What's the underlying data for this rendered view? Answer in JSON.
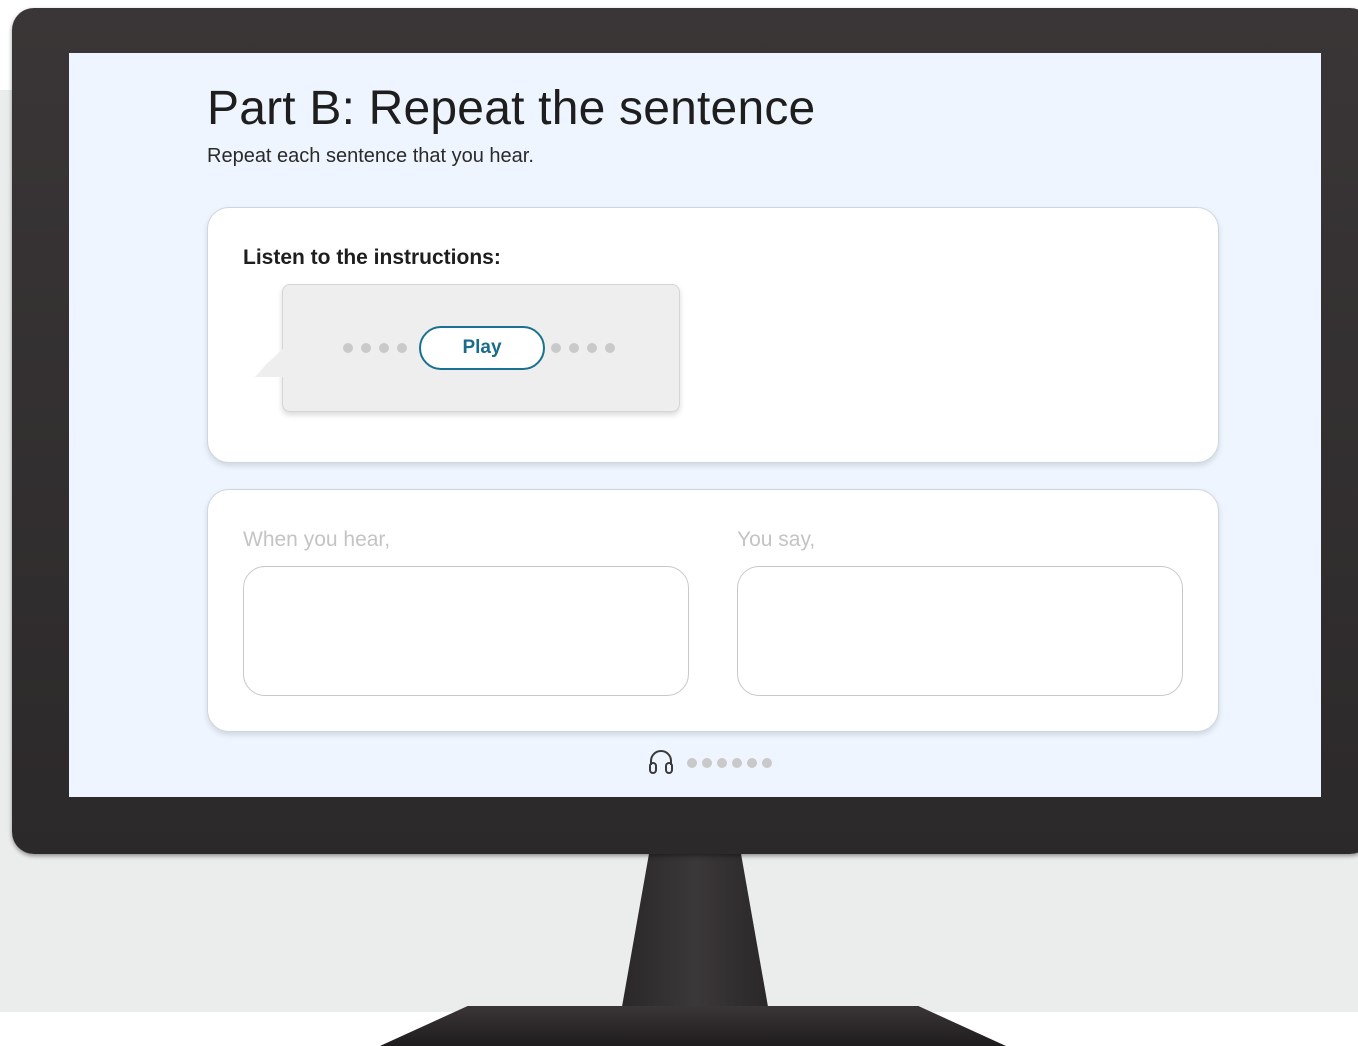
{
  "page": {
    "title": "Part B: Repeat the sentence",
    "subtitle": "Repeat each sentence that you hear."
  },
  "instructions_card": {
    "label": "Listen to the instructions:",
    "play_label": "Play"
  },
  "response_card": {
    "hear_label": "When you hear,",
    "say_label": "You say,"
  },
  "icons": {
    "footer": "headphones-icon"
  },
  "colors": {
    "accent": "#1a7090",
    "screen_background": "#eef5fe",
    "monitor_frame": "#2c292a"
  }
}
